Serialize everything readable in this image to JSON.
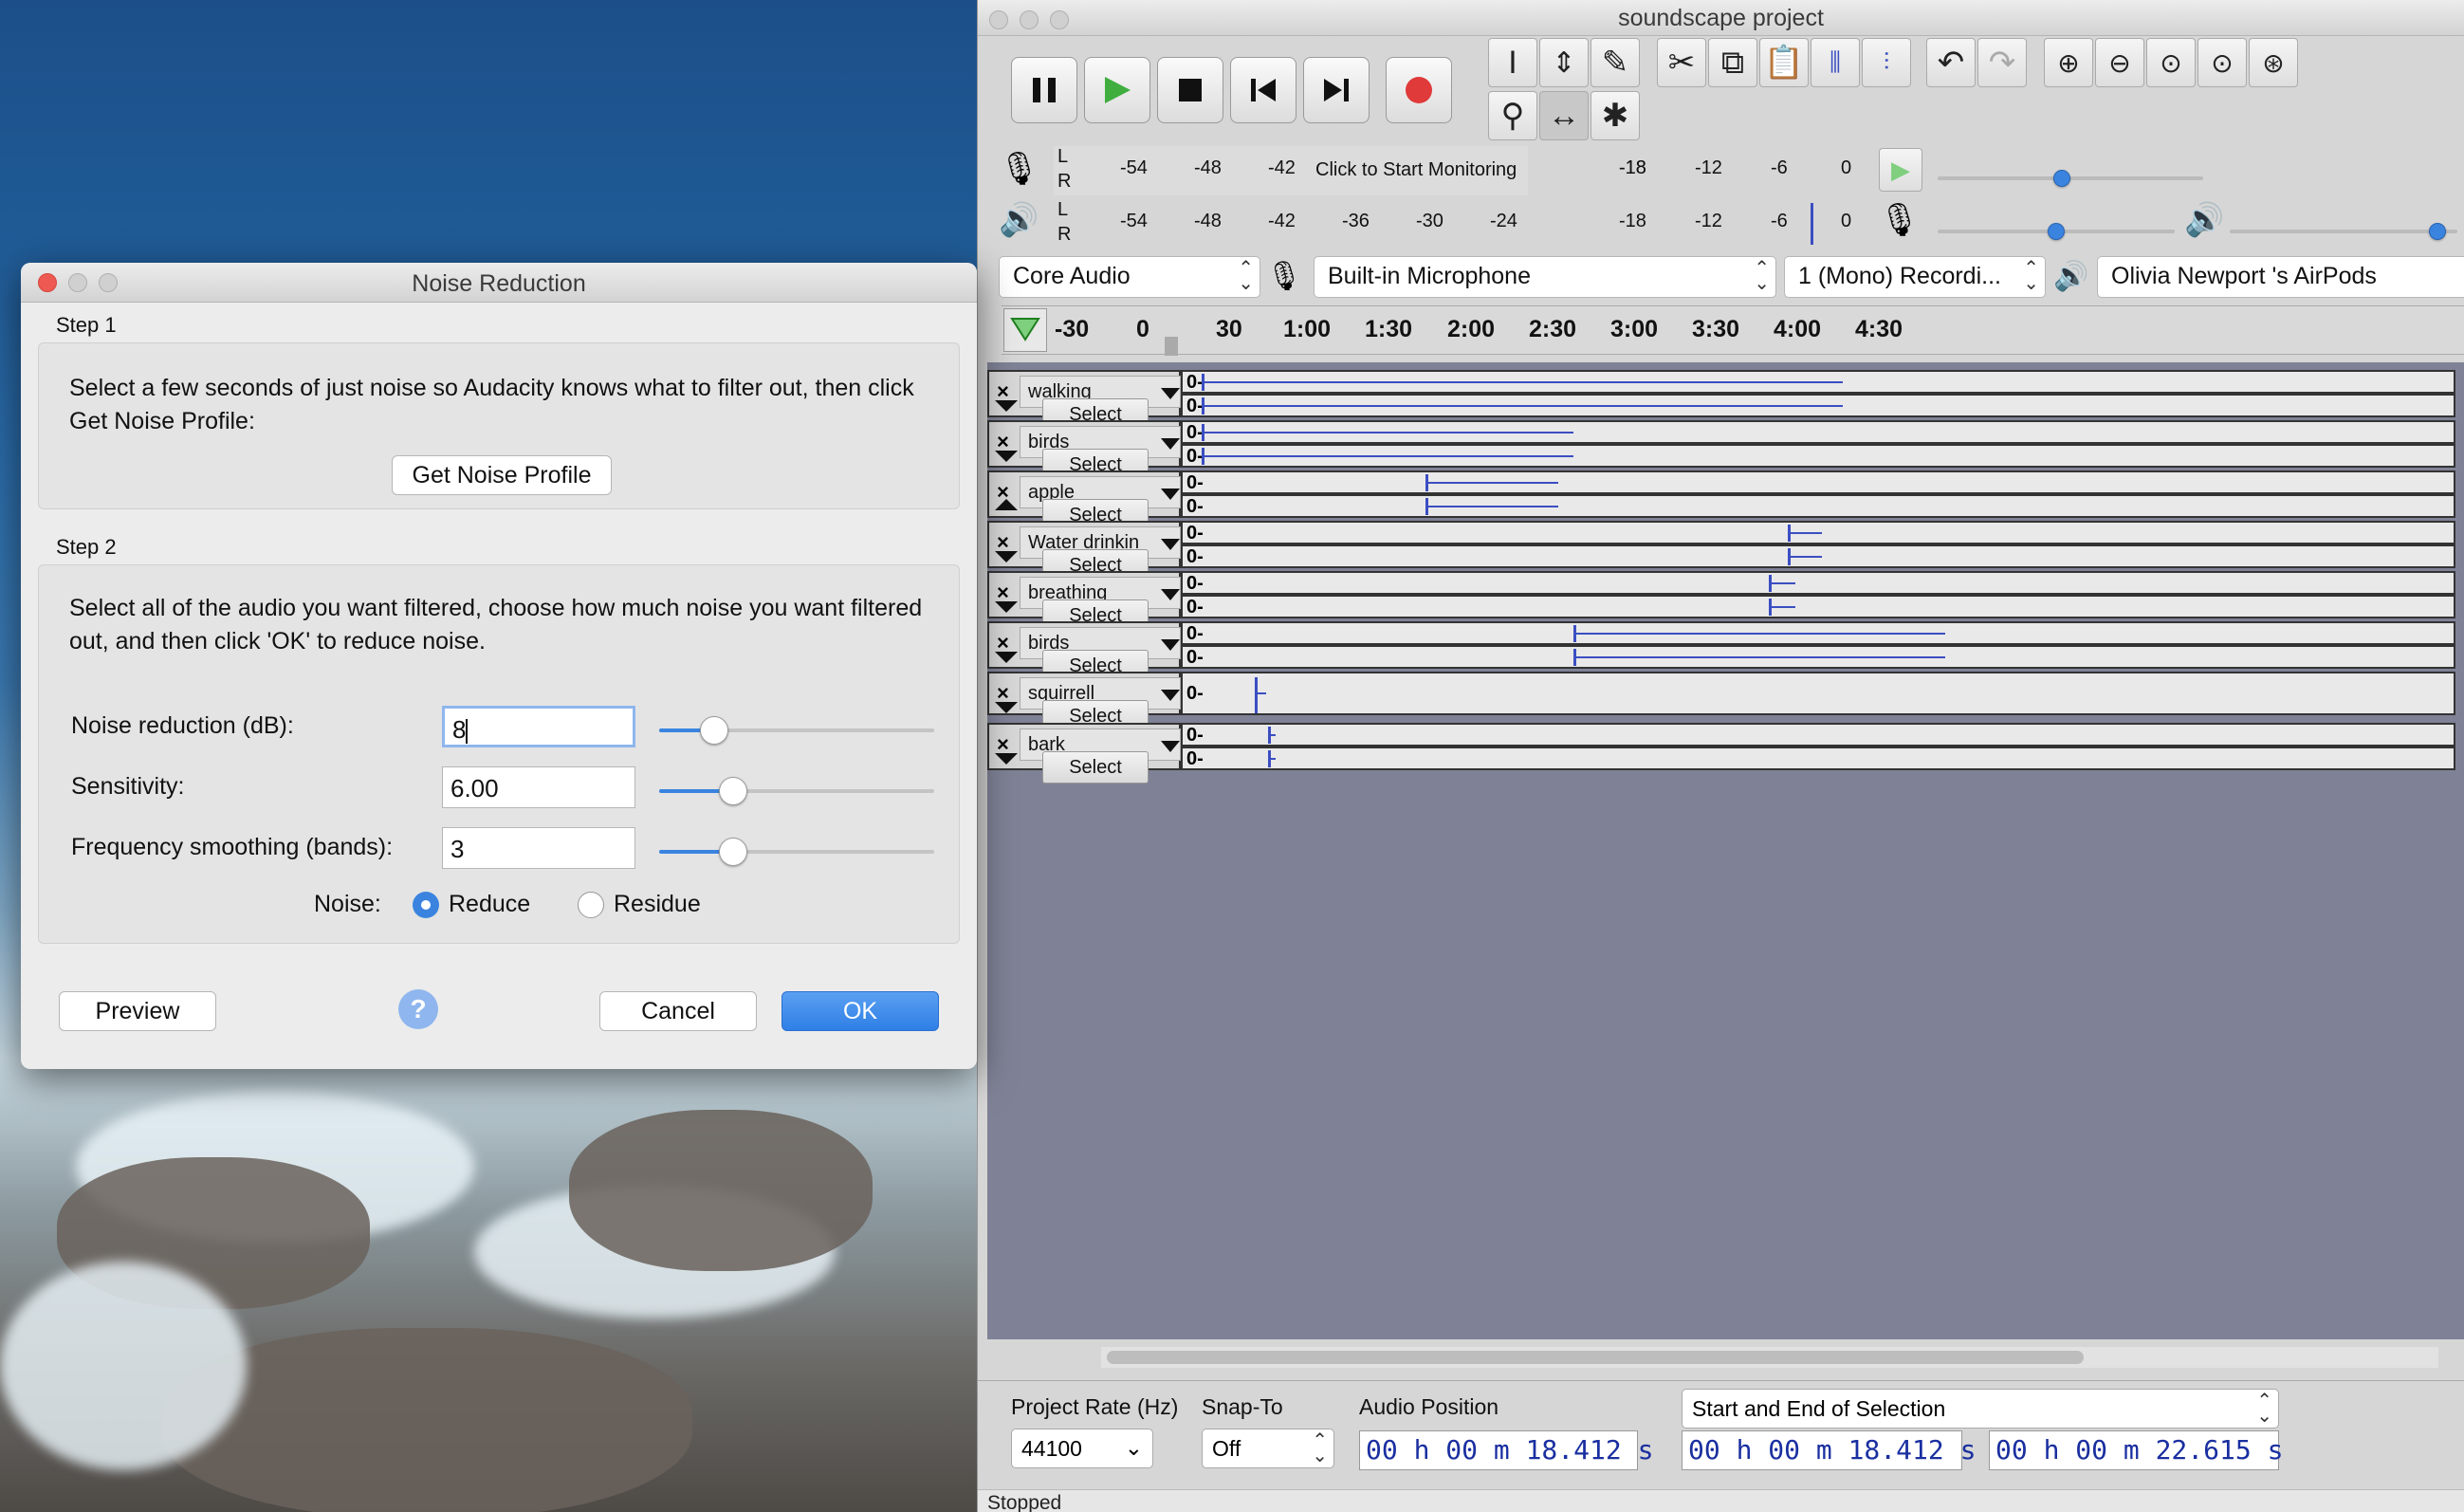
{
  "audacity": {
    "window_title": "soundscape project",
    "meter": {
      "record_ticks": [
        "-54",
        "-48",
        "-42",
        "-18",
        "-12",
        "-6",
        "0"
      ],
      "record_message": "Click to Start Monitoring",
      "play_ticks": [
        "-54",
        "-48",
        "-42",
        "-36",
        "-30",
        "-24",
        "-18",
        "-12",
        "-6",
        "0"
      ],
      "lr": [
        "L",
        "R"
      ]
    },
    "devices": {
      "host": "Core Audio",
      "input": "Built-in Microphone",
      "channels": "1 (Mono) Recordi...",
      "output": "Olivia Newport 's AirPods"
    },
    "ruler": [
      "-30",
      "0",
      "30",
      "1:00",
      "1:30",
      "2:00",
      "2:30",
      "3:00",
      "3:30",
      "4:00",
      "4:30"
    ],
    "tracks": [
      {
        "name": "walking",
        "select": "Select",
        "zero": "0-"
      },
      {
        "name": "birds",
        "select": "Select",
        "zero": "0-"
      },
      {
        "name": "apple",
        "select": "Select",
        "zero": "0-"
      },
      {
        "name": "Water drinkin",
        "select": "Select",
        "zero": "0-"
      },
      {
        "name": "breathing",
        "select": "Select",
        "zero": "0-"
      },
      {
        "name": "birds",
        "select": "Select",
        "zero": "0-"
      },
      {
        "name": "squirrell",
        "select": "Select",
        "zero": "0-"
      },
      {
        "name": "bark",
        "select": "Select",
        "zero": "0-"
      }
    ],
    "bottom": {
      "rate_label": "Project Rate (Hz)",
      "rate_value": "44100",
      "snap_label": "Snap-To",
      "snap_value": "Off",
      "pos_label": "Audio Position",
      "pos_value": "00 h 00 m 18.412 s",
      "sel_mode": "Start and End of Selection",
      "sel_start": "00 h 00 m 18.412 s",
      "sel_end": "00 h 00 m 22.615 s"
    },
    "status": "Stopped"
  },
  "dialog": {
    "title": "Noise Reduction",
    "step1_label": "Step 1",
    "step1_text": "Select a few seconds of just noise so Audacity knows what to filter out, then click Get Noise Profile:",
    "get_profile": "Get Noise Profile",
    "step2_label": "Step 2",
    "step2_text": "Select all of the audio you want filtered, choose how much noise you want filtered out, and then click 'OK' to reduce noise.",
    "fields": [
      {
        "label": "Noise reduction (dB):",
        "value": "8",
        "slider": 0.2
      },
      {
        "label": "Sensitivity:",
        "value": "6.00",
        "slider": 0.27
      },
      {
        "label": "Frequency smoothing (bands):",
        "value": "3",
        "slider": 0.27
      }
    ],
    "noise_label": "Noise:",
    "reduce_label": "Reduce",
    "residue_label": "Residue",
    "selected_mode": "Reduce",
    "preview": "Preview",
    "cancel": "Cancel",
    "ok": "OK",
    "help": "?"
  },
  "colors": {
    "accent": "#3a84e0",
    "wave": "#3b4ec2",
    "record": "#e03a3a",
    "play": "#3fae3f",
    "close": "#ee5a52"
  }
}
